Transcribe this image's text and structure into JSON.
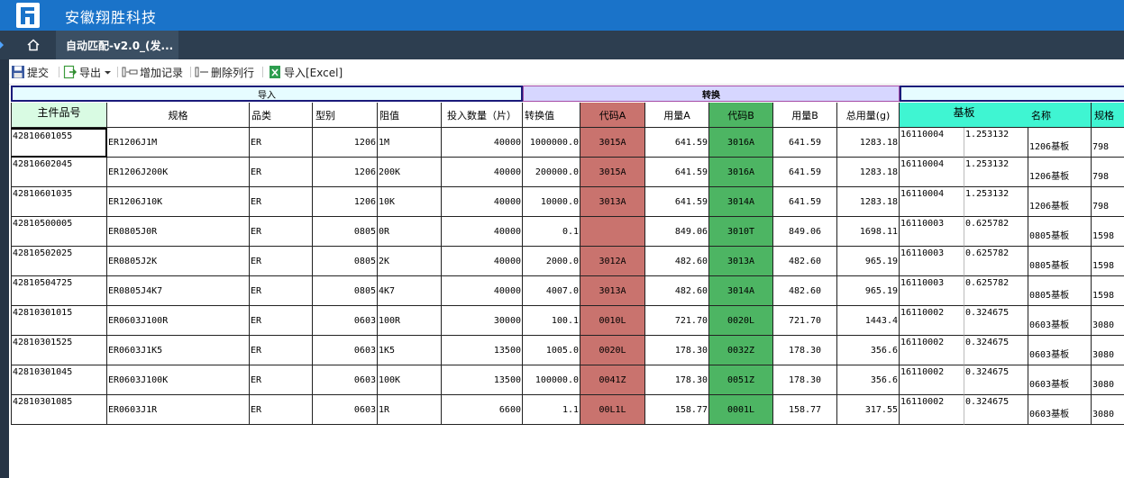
{
  "app": {
    "title": "安徽翔胜科技"
  },
  "nav": {
    "tab_label": "自动匹配-v2.0_(发..."
  },
  "toolbar": {
    "submit": "提交",
    "export": "导出",
    "add_record": "增加记录",
    "delete_row": "删除列行",
    "import_excel": "导入[Excel]"
  },
  "groups": {
    "import": "导入",
    "convert": "转换",
    "substrate": "基板"
  },
  "columns": {
    "part_no": "主件品号",
    "spec": "规格",
    "category": "品类",
    "model": "型别",
    "resistance": "阻值",
    "qty": "投入数量（片）",
    "conv_value": "转换值",
    "code_a": "代码A",
    "usage_a": "用量A",
    "code_b": "代码B",
    "usage_b": "用量B",
    "total": "总用量(g)",
    "sub_name": "名称",
    "sub_spec": "规格"
  },
  "rows": [
    {
      "part_no": "42810601055",
      "spec": "ER1206J1M",
      "category": "ER",
      "model": "1206",
      "resistance": "1M",
      "qty": "40000",
      "conv": "1000000.0",
      "code_a": "3015A",
      "usage_a": "641.59",
      "code_b": "3016A",
      "usage_b": "641.59",
      "total": "1283.18",
      "sub_code": "16110004",
      "sub_ratio": "1.253132",
      "sub_name": "1206基板",
      "sub_spec": "798"
    },
    {
      "part_no": "42810602045",
      "spec": "ER1206J200K",
      "category": "ER",
      "model": "1206",
      "resistance": "200K",
      "qty": "40000",
      "conv": "200000.0",
      "code_a": "3015A",
      "usage_a": "641.59",
      "code_b": "3016A",
      "usage_b": "641.59",
      "total": "1283.18",
      "sub_code": "16110004",
      "sub_ratio": "1.253132",
      "sub_name": "1206基板",
      "sub_spec": "798"
    },
    {
      "part_no": "42810601035",
      "spec": "ER1206J10K",
      "category": "ER",
      "model": "1206",
      "resistance": "10K",
      "qty": "40000",
      "conv": "10000.0",
      "code_a": "3013A",
      "usage_a": "641.59",
      "code_b": "3014A",
      "usage_b": "641.59",
      "total": "1283.18",
      "sub_code": "16110004",
      "sub_ratio": "1.253132",
      "sub_name": "1206基板",
      "sub_spec": "798"
    },
    {
      "part_no": "42810500005",
      "spec": "ER0805J0R",
      "category": "ER",
      "model": "0805",
      "resistance": "0R",
      "qty": "40000",
      "conv": "0.1",
      "code_a": "",
      "usage_a": "849.06",
      "code_b": "3010T",
      "usage_b": "849.06",
      "total": "1698.11",
      "sub_code": "16110003",
      "sub_ratio": "0.625782",
      "sub_name": "0805基板",
      "sub_spec": "1598"
    },
    {
      "part_no": "42810502025",
      "spec": "ER0805J2K",
      "category": "ER",
      "model": "0805",
      "resistance": "2K",
      "qty": "40000",
      "conv": "2000.0",
      "code_a": "3012A",
      "usage_a": "482.60",
      "code_b": "3013A",
      "usage_b": "482.60",
      "total": "965.19",
      "sub_code": "16110003",
      "sub_ratio": "0.625782",
      "sub_name": "0805基板",
      "sub_spec": "1598"
    },
    {
      "part_no": "42810504725",
      "spec": "ER0805J4K7",
      "category": "ER",
      "model": "0805",
      "resistance": "4K7",
      "qty": "40000",
      "conv": "4007.0",
      "code_a": "3013A",
      "usage_a": "482.60",
      "code_b": "3014A",
      "usage_b": "482.60",
      "total": "965.19",
      "sub_code": "16110003",
      "sub_ratio": "0.625782",
      "sub_name": "0805基板",
      "sub_spec": "1598"
    },
    {
      "part_no": "42810301015",
      "spec": "ER0603J100R",
      "category": "ER",
      "model": "0603",
      "resistance": "100R",
      "qty": "30000",
      "conv": "100.1",
      "code_a": "0010L",
      "usage_a": "721.70",
      "code_b": "0020L",
      "usage_b": "721.70",
      "total": "1443.4",
      "sub_code": "16110002",
      "sub_ratio": "0.324675",
      "sub_name": "0603基板",
      "sub_spec": "3080"
    },
    {
      "part_no": "42810301525",
      "spec": "ER0603J1K5",
      "category": "ER",
      "model": "0603",
      "resistance": "1K5",
      "qty": "13500",
      "conv": "1005.0",
      "code_a": "0020L",
      "usage_a": "178.30",
      "code_b": "0032Z",
      "usage_b": "178.30",
      "total": "356.6",
      "sub_code": "16110002",
      "sub_ratio": "0.324675",
      "sub_name": "0603基板",
      "sub_spec": "3080"
    },
    {
      "part_no": "42810301045",
      "spec": "ER0603J100K",
      "category": "ER",
      "model": "0603",
      "resistance": "100K",
      "qty": "13500",
      "conv": "100000.0",
      "code_a": "0041Z",
      "usage_a": "178.30",
      "code_b": "0051Z",
      "usage_b": "178.30",
      "total": "356.6",
      "sub_code": "16110002",
      "sub_ratio": "0.324675",
      "sub_name": "0603基板",
      "sub_spec": "3080"
    },
    {
      "part_no": "42810301085",
      "spec": "ER0603J1R",
      "category": "ER",
      "model": "0603",
      "resistance": "1R",
      "qty": "6600",
      "conv": "1.1",
      "code_a": "00L1L",
      "usage_a": "158.77",
      "code_b": "0001L",
      "usage_b": "158.77",
      "total": "317.55",
      "sub_code": "16110002",
      "sub_ratio": "0.324675",
      "sub_name": "0603基板",
      "sub_spec": "3080"
    }
  ],
  "colors": {
    "brand": "#1a73c9",
    "code_a": "#c9736e",
    "code_b": "#4db563",
    "substrate_header": "#3ff5d2",
    "import_group": "#e6fcff",
    "convert_group": "#d6d6ff"
  }
}
